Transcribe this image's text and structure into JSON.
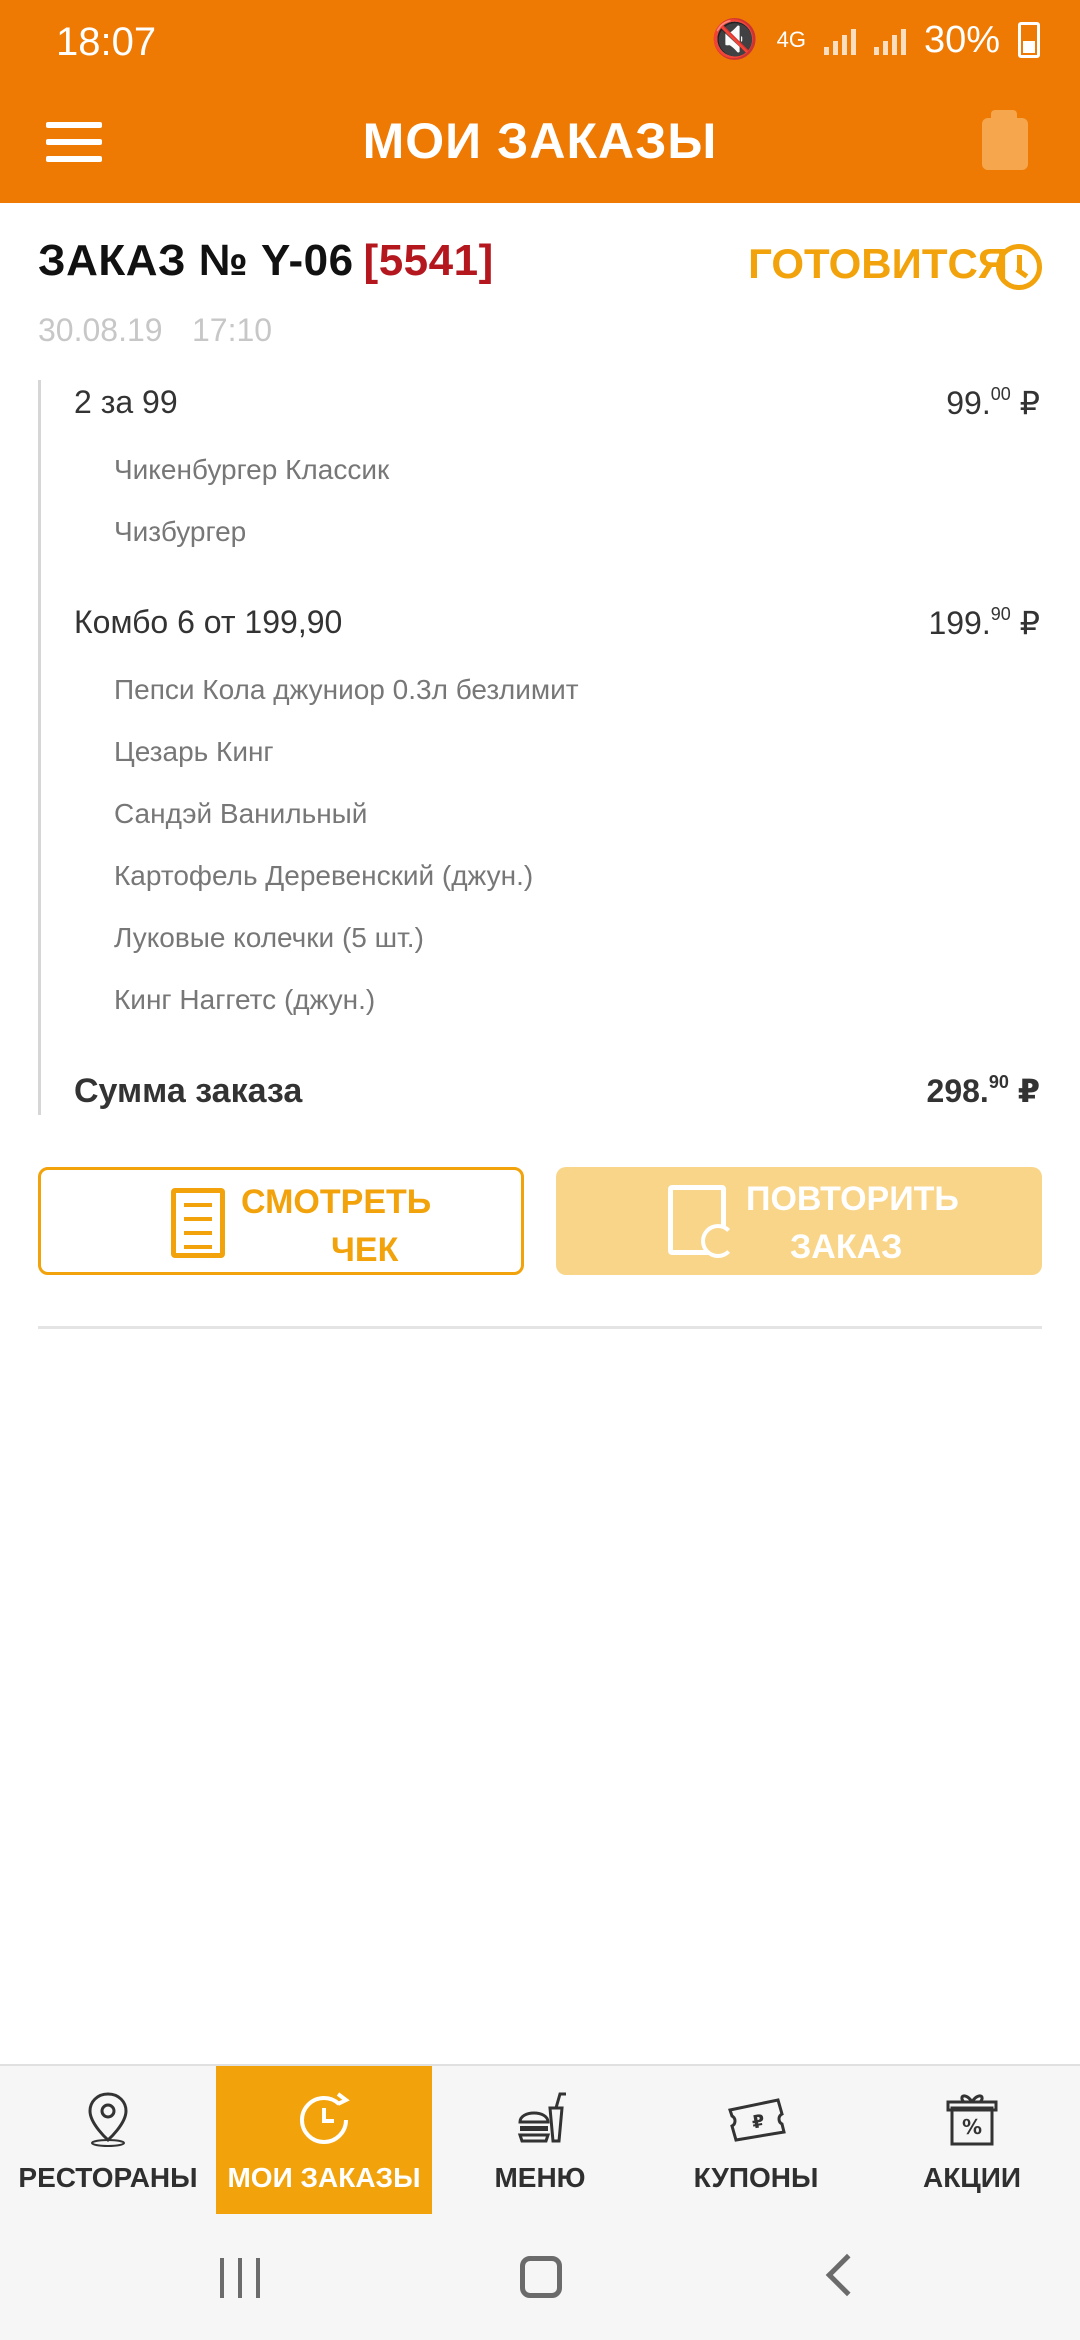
{
  "status_bar": {
    "time": "18:07",
    "network": "4G",
    "battery": "30%"
  },
  "header": {
    "title": "МОИ ЗАКАЗЫ"
  },
  "order": {
    "title": "ЗАКАЗ № Y-06",
    "code": "[5541]",
    "status": "ГОТОВИТСЯ",
    "date": "30.08.19",
    "time": "17:10",
    "items": [
      {
        "name": "2 за 99",
        "price_main": "99.",
        "price_cents": "00",
        "currency": "₽",
        "subitems": [
          "Чикенбургер Классик",
          "Чизбургер"
        ]
      },
      {
        "name": "Комбо 6 от 199,90",
        "price_main": "199.",
        "price_cents": "90",
        "currency": "₽",
        "subitems": [
          "Пепси Кола джуниор 0.3л безлимит",
          "Цезарь Кинг",
          "Сандэй Ванильный",
          "Картофель Деревенский (джун.)",
          "Луковые колечки (5 шт.)",
          "Кинг Наггетс (джун.)"
        ]
      }
    ],
    "total_label": "Сумма заказа",
    "total_main": "298.",
    "total_cents": "90",
    "total_currency": "₽"
  },
  "buttons": {
    "check_line1": "СМОТРЕТЬ",
    "check_line2": "ЧЕК",
    "repeat_line1": "ПОВТОРИТЬ",
    "repeat_line2": "ЗАКАЗ"
  },
  "bottom_nav": [
    {
      "label": "РЕСТОРАНЫ",
      "icon": "map-pin-icon"
    },
    {
      "label": "МОИ ЗАКАЗЫ",
      "icon": "order-history-icon",
      "active": true
    },
    {
      "label": "МЕНЮ",
      "icon": "burger-drink-icon"
    },
    {
      "label": "КУПОНЫ",
      "icon": "coupon-icon"
    },
    {
      "label": "АКЦИИ",
      "icon": "gift-percent-icon"
    }
  ],
  "colors": {
    "orange": "#ee7a03",
    "accent": "#f2a20a",
    "code_red": "#b5171f"
  }
}
